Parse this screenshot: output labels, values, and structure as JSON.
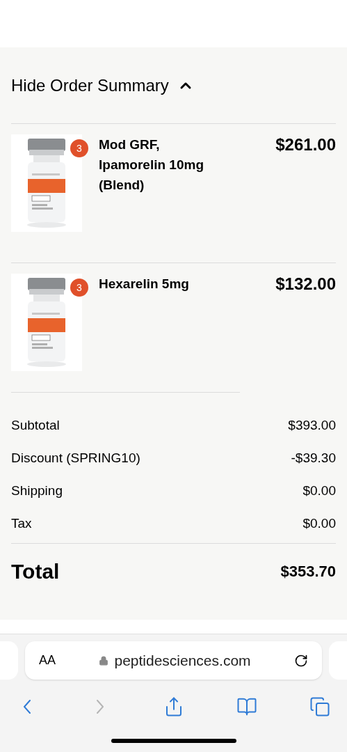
{
  "order_summary": {
    "toggle_label": "Hide Order Summary",
    "expanded": true,
    "items": [
      {
        "quantity": "3",
        "name": "Mod GRF, Ipamorelin 10mg (Blend)",
        "price": "$261.00"
      },
      {
        "quantity": "3",
        "name": "Hexarelin 5mg",
        "price": "$132.00"
      }
    ],
    "lines": [
      {
        "label": "Subtotal",
        "value": "$393.00"
      },
      {
        "label": "Discount (SPRING10)",
        "value": "-$39.30"
      },
      {
        "label": "Shipping",
        "value": "$0.00"
      },
      {
        "label": "Tax",
        "value": "$0.00"
      }
    ],
    "total": {
      "label": "Total",
      "value": "$353.70"
    }
  },
  "browser": {
    "text_size_button": "AA",
    "url": "peptidesciences.com",
    "toolbar": [
      {
        "kind": "back",
        "disabled": false
      },
      {
        "kind": "forward",
        "disabled": true
      },
      {
        "kind": "share",
        "disabled": false
      },
      {
        "kind": "bookmarks",
        "disabled": false
      },
      {
        "kind": "tabs",
        "disabled": false
      }
    ]
  }
}
